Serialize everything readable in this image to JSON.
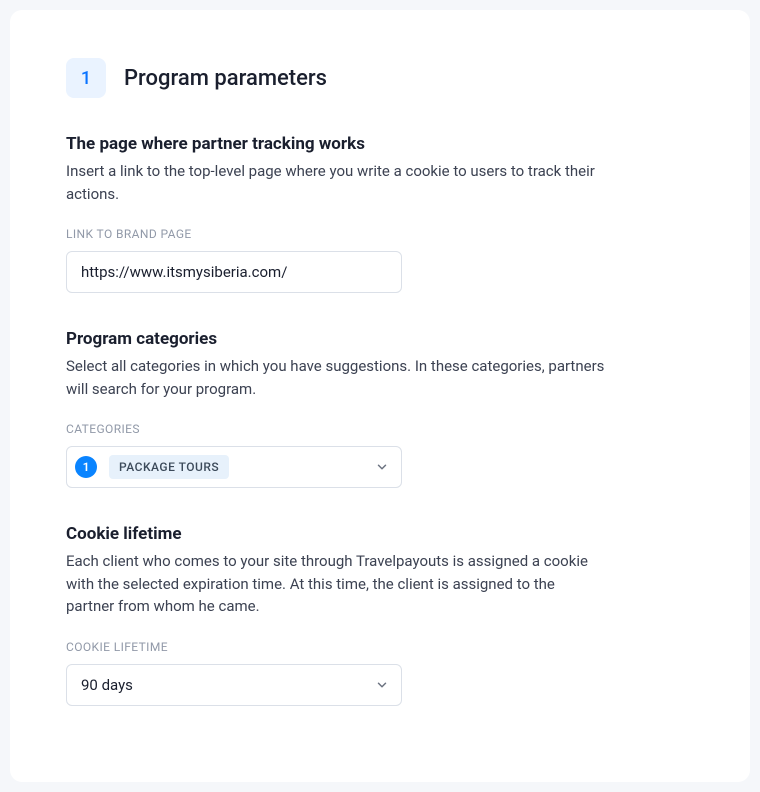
{
  "step": {
    "number": "1",
    "title": "Program parameters"
  },
  "sections": {
    "tracking": {
      "title": "The page where partner tracking works",
      "desc": "Insert a link to the top-level page where you write a cookie to users to track their actions.",
      "label": "LINK TO BRAND PAGE",
      "value": "https://www.itsmysiberia.com/"
    },
    "categories": {
      "title": "Program categories",
      "desc": "Select all categories in which you have suggestions. In these categories, partners will search for your program.",
      "label": "CATEGORIES",
      "count": "1",
      "selected": "PACKAGE TOURS"
    },
    "cookie": {
      "title": "Cookie lifetime",
      "desc": "Each client who comes to your site through Travelpayouts is assigned a cookie with the selected expiration time. At this time, the client is assigned to the partner from whom he came.",
      "label": "COOKIE LIFETIME",
      "value": "90 days"
    }
  }
}
